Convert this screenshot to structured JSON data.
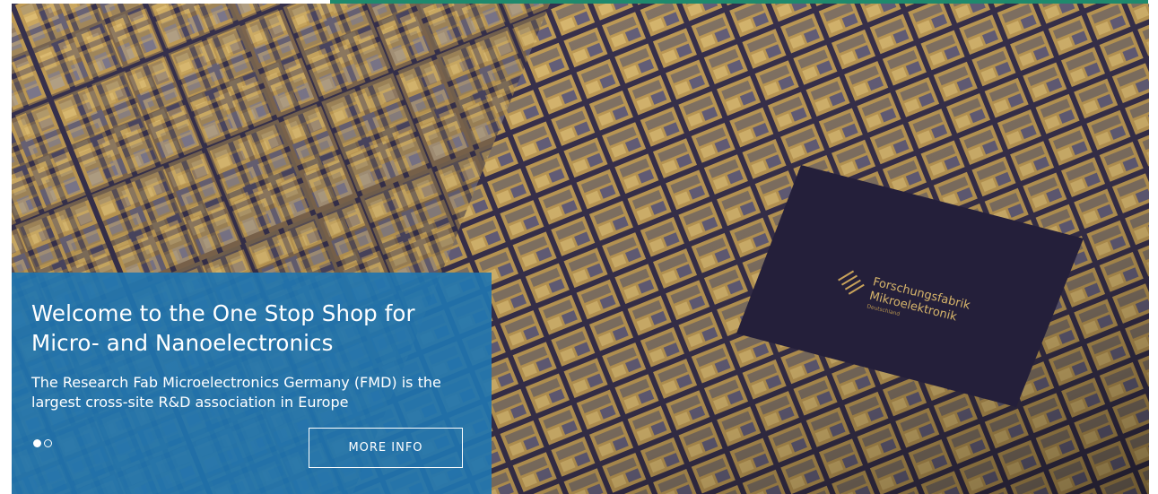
{
  "hero": {
    "title": "Welcome to the One Stop Shop for Micro- and Nanoelectronics",
    "subtitle": "The Research Fab Microelectronics Germany (FMD) is the largest cross-site R&D association in Europe",
    "cta_label": "MORE INFO",
    "slides_total": 2,
    "active_slide": 1,
    "chip_label_line1": "Forschungsfabrik",
    "chip_label_line2": "Mikroelektronik",
    "chip_label_line3": "Deutschland"
  },
  "colors": {
    "accent_bar": "#1f8a6d",
    "box_blue": "#2075b0"
  },
  "icons": {
    "logo": "fmd-logo-icon"
  }
}
